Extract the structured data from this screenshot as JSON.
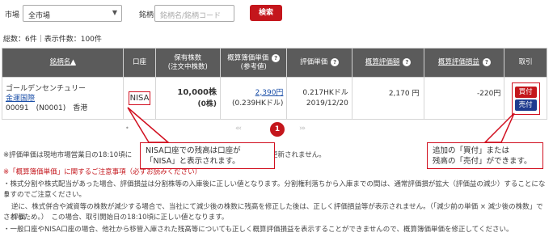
{
  "search": {
    "market_label": "市場",
    "market_value": "全市場",
    "brand_label": "銘柄",
    "brand_placeholder": "銘柄名/銘柄コード",
    "search_button": "検索"
  },
  "summary": {
    "count_text": "総数：6件｜表示件数：100件"
  },
  "table": {
    "headers": {
      "name": "銘柄名▲",
      "account": "口座",
      "shares_line1": "保有株数",
      "shares_line2": "(注文中株数)",
      "book_line1": "概算簿価単価",
      "book_line2": "(参考値)",
      "valuation_unit": "評価単価",
      "valuation_amount": "概算評価額",
      "pl": "概算評価損益",
      "trade": "取引"
    },
    "row": {
      "company": "ゴールデンセンチュリー",
      "sub_name": "金運国際",
      "code": "00091　(N0001)　香港",
      "account": "NISA",
      "shares": "10,000株",
      "pending": "(0株)",
      "book_price": "2,390円",
      "book_price_hkd": "(0.239HKドル)",
      "unit_price": "0.217HKドル",
      "unit_date": "2019/12/20",
      "amount": "2,170 円",
      "pl": "-220円",
      "buy": "買付",
      "sell": "売付"
    }
  },
  "pager": {
    "prev": "« ‹",
    "current": "1",
    "next": "› »",
    "dot": "•"
  },
  "callouts": {
    "nisa_line1": "NISA口座での残高は口座が",
    "nisa_line2": "「NISA」と表示されます。",
    "trade_line1": "追加の「買付」または",
    "trade_line2": "残高の「売付」ができます。"
  },
  "notes": {
    "note1_left": "※評価単価は現地市場営業日の18:10頃に",
    "note1_right": "ムで更新されません。",
    "heading": "※「概算簿価単価」に関するご注意事項（必ずお読みください）",
    "line1": "・株式分割や株式配当があった場合、評価損益は分割株等の入庫後に正しい値となります。分割権利落ちから入庫までの間は、通常評価損が拡大（評価益の減少）することになり",
    "line2": "ますのでご注意ください。",
    "line3": "逆に、株式併合や減資等の株数が減少する場合で、当社にて減少後の株数に残高を修正した後は、正しく評価損益等が表示されません。（「減少前の単価 × 減少後の株数」で評価",
    "line4": "されるため。）　この場合、取引開始日の18:10頃に正しい値となります。",
    "line5": "・一般口座やNISA口座の場合、他社から移管入庫された残高等についても正しく概算評価損益を表示することができませんので、概算簿価単価を修正してください。"
  }
}
